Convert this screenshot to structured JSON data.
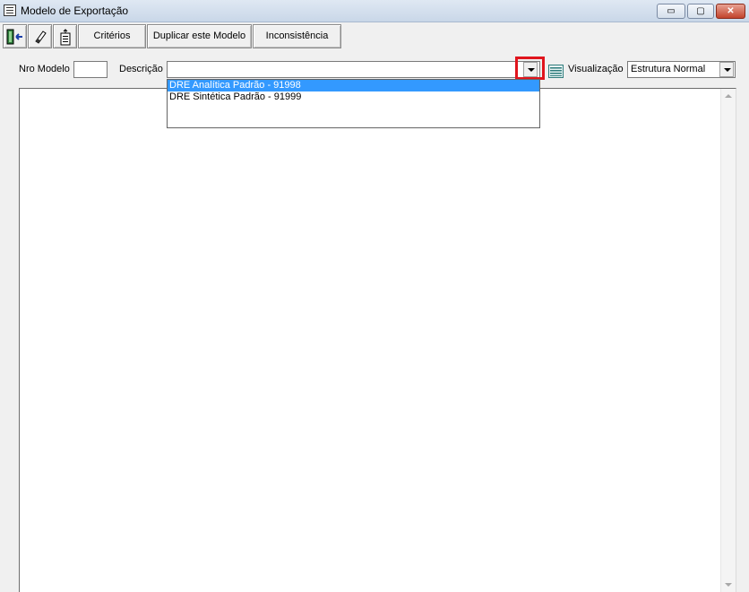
{
  "window": {
    "title": "Modelo de Exportação",
    "controls": {
      "minimize": "▭",
      "maximize": "▢",
      "close": "✕"
    }
  },
  "toolbar": {
    "icons": [
      "exit-icon",
      "eraser-icon",
      "export-icon"
    ],
    "buttons": [
      "Critérios",
      "Duplicar este Modelo",
      "Inconsistência"
    ]
  },
  "form": {
    "nro_modelo_label": "Nro Modelo",
    "nro_modelo_value": "",
    "descricao_label": "Descrição",
    "descricao_value": "",
    "visualizacao_label": "Visualização",
    "visualizacao_value": "Estrutura Normal"
  },
  "dropdown": {
    "options": [
      "DRE Analítica Padrão - 91998",
      "DRE Sintética Padrão - 91999"
    ],
    "selected_index": 0
  },
  "colors": {
    "highlight": "#3399ff",
    "annotation": "#e0151d"
  }
}
